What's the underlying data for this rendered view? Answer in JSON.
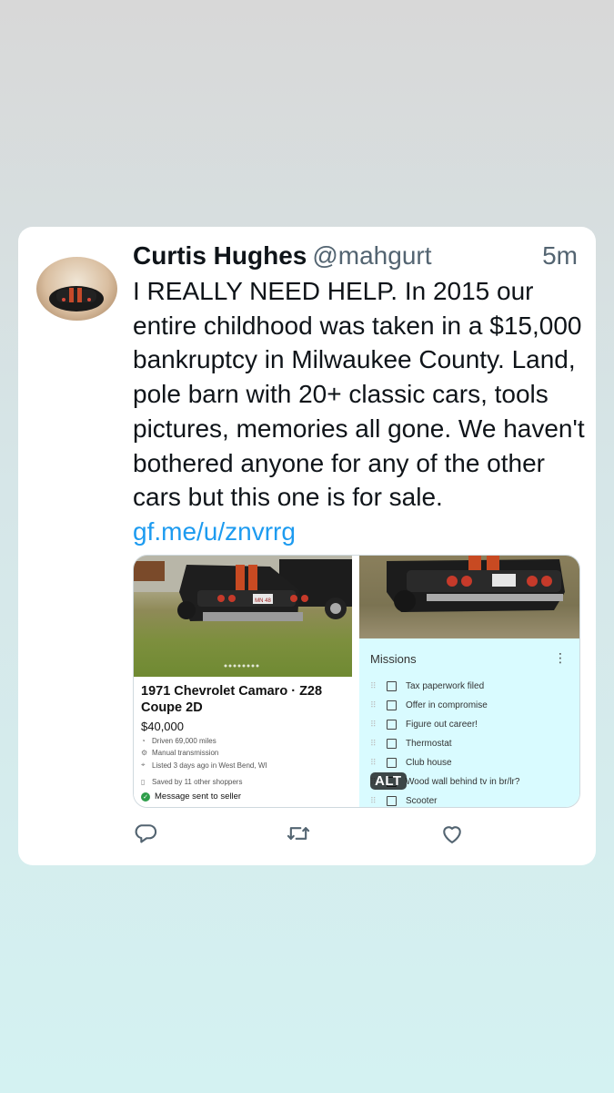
{
  "tweet": {
    "name": "Curtis Hughes",
    "handle": "@mahgurt",
    "time": "5m",
    "text": "I REALLY NEED HELP. In 2015 our entire childhood was taken in a $15,000 bankruptcy in Milwaukee County. Land, pole barn with 20+ classic cars, tools pictures, memories all gone. We haven't bothered anyone for any of the other cars but this one is for sale. ",
    "link": "gf.me/u/znvrrg"
  },
  "listing": {
    "title": "1971 Chevrolet Camaro · Z28 Coupe 2D",
    "price": "$40,000",
    "driven": "Driven 69,000 miles",
    "transmission": "Manual transmission",
    "listed": "Listed 3 days ago in West Bend, WI",
    "saved": "Saved by 11 other shoppers",
    "message": "Message sent to seller",
    "plate_text": "MN 48"
  },
  "missions": {
    "title": "Missions",
    "menu_icon": "⋮",
    "items": [
      "Tax paperwork filed",
      "Offer in compromise",
      "Figure out career!",
      "Thermostat",
      "Club house",
      "Wood wall behind tv in br/lr?",
      "Scooter"
    ]
  },
  "alt_badge": "ALT",
  "colors": {
    "link": "#1d9bf0",
    "secondary_text": "#536471",
    "missions_bg": "#d9fbff"
  },
  "icons": [
    "reply-icon",
    "retweet-icon",
    "like-icon"
  ]
}
